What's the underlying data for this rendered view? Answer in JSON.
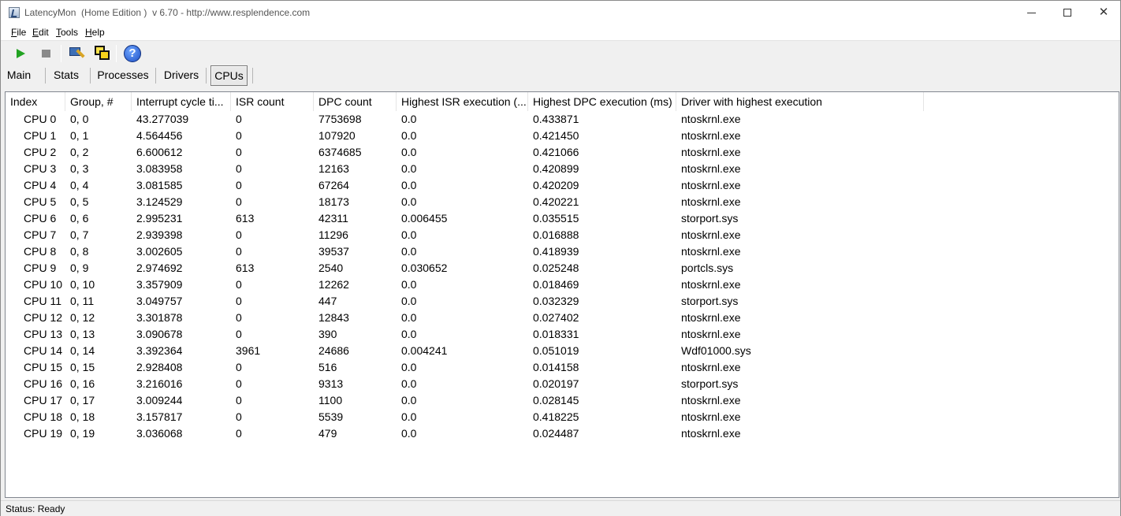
{
  "window": {
    "title": "LatencyMon  (Home Edition )  v 6.70 - http://www.resplendence.com"
  },
  "menu": [
    {
      "hot": "F",
      "rest": "ile"
    },
    {
      "hot": "E",
      "rest": "dit"
    },
    {
      "hot": "T",
      "rest": "ools"
    },
    {
      "hot": "H",
      "rest": "elp"
    }
  ],
  "toolbar": {
    "icons": [
      "play-icon",
      "stop-icon",
      "driver-info-icon",
      "windows-icon",
      "help-icon"
    ],
    "help_glyph": "?"
  },
  "tabs": [
    "Main",
    "Stats",
    "Processes",
    "Drivers",
    "CPUs"
  ],
  "active_tab": "CPUs",
  "table": {
    "columns": [
      "Index",
      "Group, #",
      "Interrupt cycle ti...",
      "ISR count",
      "DPC count",
      "Highest ISR execution (...",
      "Highest DPC execution (ms)",
      "Driver with highest execution"
    ],
    "rows": [
      [
        "CPU 0",
        "0, 0",
        "43.277039",
        "0",
        "7753698",
        "0.0",
        "0.433871",
        "ntoskrnl.exe"
      ],
      [
        "CPU 1",
        "0, 1",
        "4.564456",
        "0",
        "107920",
        "0.0",
        "0.421450",
        "ntoskrnl.exe"
      ],
      [
        "CPU 2",
        "0, 2",
        "6.600612",
        "0",
        "6374685",
        "0.0",
        "0.421066",
        "ntoskrnl.exe"
      ],
      [
        "CPU 3",
        "0, 3",
        "3.083958",
        "0",
        "12163",
        "0.0",
        "0.420899",
        "ntoskrnl.exe"
      ],
      [
        "CPU 4",
        "0, 4",
        "3.081585",
        "0",
        "67264",
        "0.0",
        "0.420209",
        "ntoskrnl.exe"
      ],
      [
        "CPU 5",
        "0, 5",
        "3.124529",
        "0",
        "18173",
        "0.0",
        "0.420221",
        "ntoskrnl.exe"
      ],
      [
        "CPU 6",
        "0, 6",
        "2.995231",
        "613",
        "42311",
        "0.006455",
        "0.035515",
        "storport.sys"
      ],
      [
        "CPU 7",
        "0, 7",
        "2.939398",
        "0",
        "11296",
        "0.0",
        "0.016888",
        "ntoskrnl.exe"
      ],
      [
        "CPU 8",
        "0, 8",
        "3.002605",
        "0",
        "39537",
        "0.0",
        "0.418939",
        "ntoskrnl.exe"
      ],
      [
        "CPU 9",
        "0, 9",
        "2.974692",
        "613",
        "2540",
        "0.030652",
        "0.025248",
        "portcls.sys"
      ],
      [
        "CPU 10",
        "0, 10",
        "3.357909",
        "0",
        "12262",
        "0.0",
        "0.018469",
        "ntoskrnl.exe"
      ],
      [
        "CPU 11",
        "0, 11",
        "3.049757",
        "0",
        "447",
        "0.0",
        "0.032329",
        "storport.sys"
      ],
      [
        "CPU 12",
        "0, 12",
        "3.301878",
        "0",
        "12843",
        "0.0",
        "0.027402",
        "ntoskrnl.exe"
      ],
      [
        "CPU 13",
        "0, 13",
        "3.090678",
        "0",
        "390",
        "0.0",
        "0.018331",
        "ntoskrnl.exe"
      ],
      [
        "CPU 14",
        "0, 14",
        "3.392364",
        "3961",
        "24686",
        "0.004241",
        "0.051019",
        "Wdf01000.sys"
      ],
      [
        "CPU 15",
        "0, 15",
        "2.928408",
        "0",
        "516",
        "0.0",
        "0.014158",
        "ntoskrnl.exe"
      ],
      [
        "CPU 16",
        "0, 16",
        "3.216016",
        "0",
        "9313",
        "0.0",
        "0.020197",
        "storport.sys"
      ],
      [
        "CPU 17",
        "0, 17",
        "3.009244",
        "0",
        "1100",
        "0.0",
        "0.028145",
        "ntoskrnl.exe"
      ],
      [
        "CPU 18",
        "0, 18",
        "3.157817",
        "0",
        "5539",
        "0.0",
        "0.418225",
        "ntoskrnl.exe"
      ],
      [
        "CPU 19",
        "0, 19",
        "3.036068",
        "0",
        "479",
        "0.0",
        "0.024487",
        "ntoskrnl.exe"
      ]
    ]
  },
  "status": "Status: Ready"
}
